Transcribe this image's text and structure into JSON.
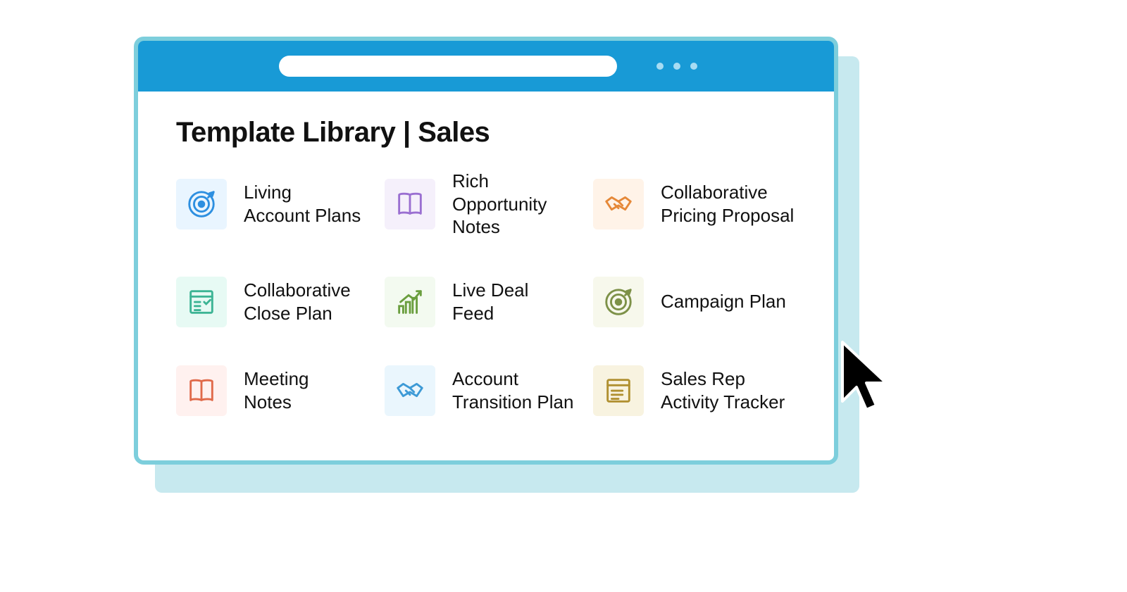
{
  "page": {
    "title": "Template Library | Sales"
  },
  "templates": [
    {
      "label": "Living\nAccount Plans"
    },
    {
      "label": "Rich Opportunity Notes"
    },
    {
      "label": "Collaborative Pricing Proposal"
    },
    {
      "label": "Collaborative Close Plan"
    },
    {
      "label": "Live Deal\nFeed"
    },
    {
      "label": "Campaign Plan"
    },
    {
      "label": "Meeting\nNotes"
    },
    {
      "label": "Account Transition Plan"
    },
    {
      "label": "Sales Rep Activity Tracker"
    }
  ]
}
